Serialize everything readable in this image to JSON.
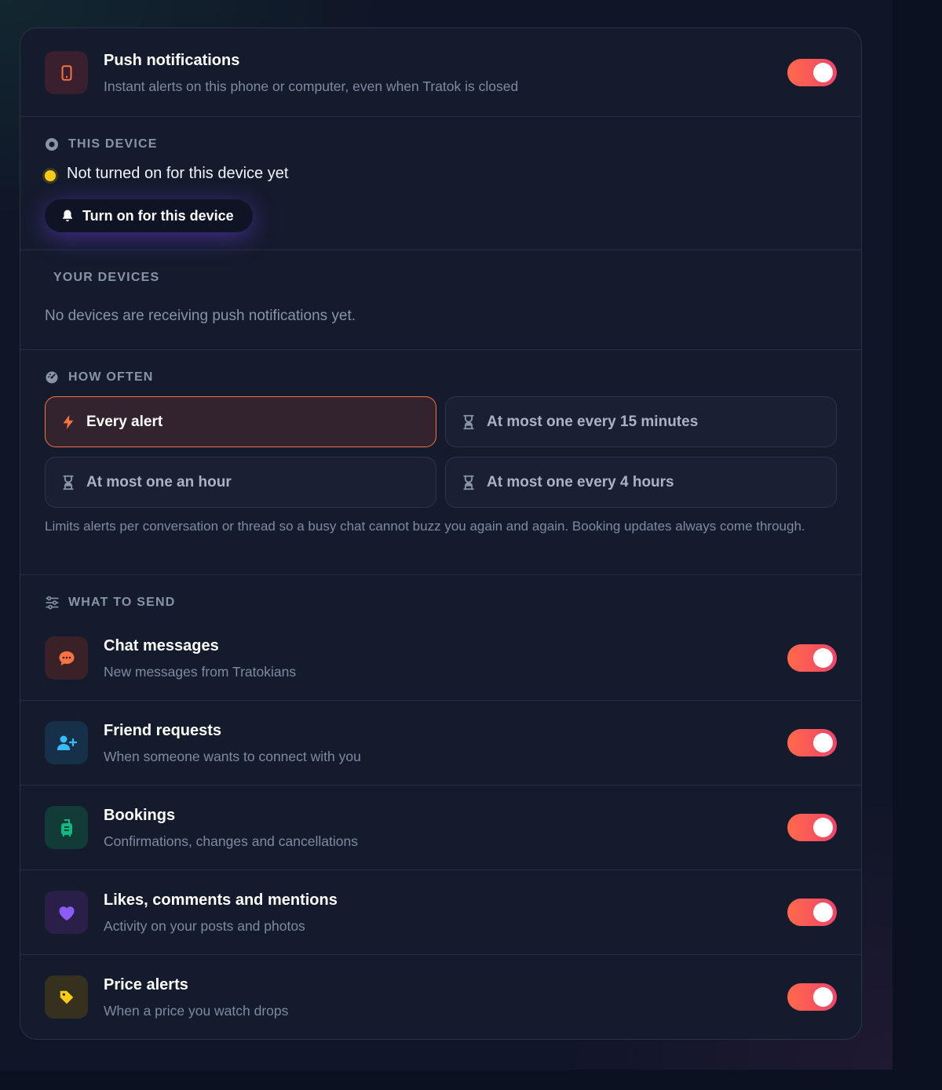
{
  "push": {
    "title": "Push notifications",
    "subtitle": "Instant alerts on this phone or computer, even when Tratok is closed",
    "enabled": true,
    "icon": "phone-icon"
  },
  "this_device": {
    "label": "THIS DEVICE",
    "status": "Not turned on for this device yet",
    "status_color": "#facc15",
    "button_label": "Turn on for this device"
  },
  "your_devices": {
    "label": "YOUR DEVICES",
    "empty_text": "No devices are receiving push notifications yet."
  },
  "how_often": {
    "label": "HOW OFTEN",
    "options": [
      {
        "label": "Every alert",
        "icon": "lightning-icon",
        "selected": true
      },
      {
        "label": "At most one every 15 minutes",
        "icon": "hourglass-icon",
        "selected": false
      },
      {
        "label": "At most one an hour",
        "icon": "hourglass-icon",
        "selected": false
      },
      {
        "label": "At most one every 4 hours",
        "icon": "hourglass-icon",
        "selected": false
      }
    ],
    "hint": "Limits alerts per conversation or thread so a busy chat cannot buzz you again and again. Booking updates always come through."
  },
  "what_to_send": {
    "label": "WHAT TO SEND",
    "items": [
      {
        "title": "Chat messages",
        "subtitle": "New messages from Tratokians",
        "enabled": true,
        "icon": "chat-bubble-icon",
        "color": "#f97340"
      },
      {
        "title": "Friend requests",
        "subtitle": "When someone wants to connect with you",
        "enabled": true,
        "icon": "add-user-icon",
        "color": "#38bdf8"
      },
      {
        "title": "Bookings",
        "subtitle": "Confirmations, changes and cancellations",
        "enabled": true,
        "icon": "luggage-icon",
        "color": "#10b981"
      },
      {
        "title": "Likes, comments and mentions",
        "subtitle": "Activity on your posts and photos",
        "enabled": true,
        "icon": "heart-icon",
        "color": "#8b5cf6"
      },
      {
        "title": "Price alerts",
        "subtitle": "When a price you watch drops",
        "enabled": true,
        "icon": "tag-icon",
        "color": "#facc15"
      }
    ]
  },
  "colors": {
    "accent": "#f97340",
    "toggle_on_start": "#ff6a4a",
    "toggle_on_end": "#f2436a",
    "card_bg": "#141b2d"
  }
}
